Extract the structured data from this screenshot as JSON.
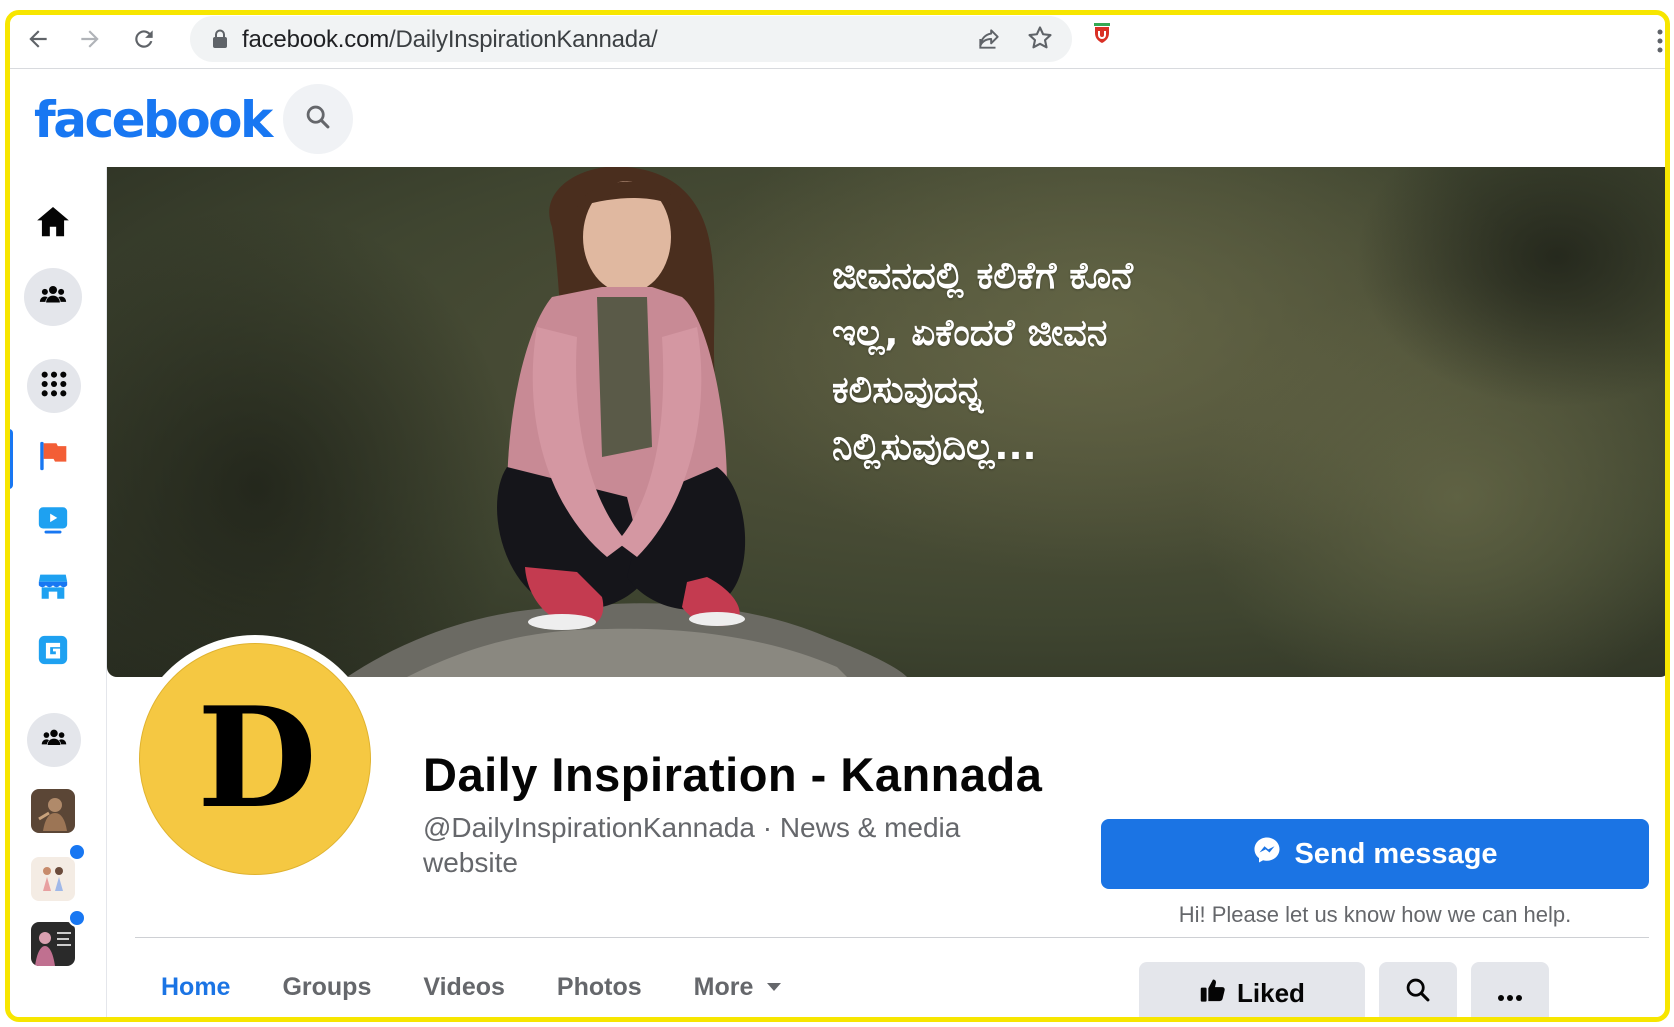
{
  "browser": {
    "url_domain": "facebook.com",
    "url_path": "/DailyInspirationKannada/"
  },
  "fb": {
    "logo": "facebook"
  },
  "cover": {
    "quote": "ಜೀವನದಲ್ಲಿ ಕಲಿಕೆಗೆ ಕೊನೆ\nಇಲ್ಲ, ಏಕೆಂದರೆ ಜೀವನ\nಕಲಿಸುವುದನ್ನ\nನಿಲ್ಲಿಸುವುದಿಲ್ಲ..."
  },
  "profile": {
    "initial": "D",
    "name": "Daily Inspiration - Kannada",
    "subtitle": "@DailyInspirationKannada · News & media website"
  },
  "actions": {
    "send_message": "Send message",
    "help_text": "Hi! Please let us know how we can help.",
    "liked": "Liked"
  },
  "tabs": [
    {
      "label": "Home",
      "active": true
    },
    {
      "label": "Groups"
    },
    {
      "label": "Videos"
    },
    {
      "label": "Photos"
    },
    {
      "label": "More"
    }
  ],
  "colors": {
    "brand": "#1877f2",
    "highlight_border": "#f7e600",
    "profile_bg": "#f5c842"
  }
}
